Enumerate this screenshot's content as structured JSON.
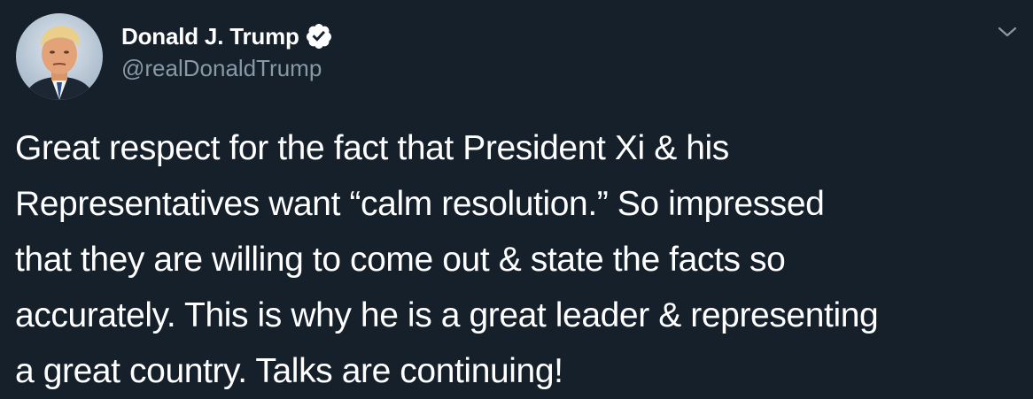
{
  "author": {
    "display_name": "Donald J. Trump",
    "handle": "@realDonaldTrump",
    "verified": true,
    "avatar_icon": "profile-photo",
    "verified_icon": "verified-badge-icon"
  },
  "menu": {
    "icon": "chevron-down-icon"
  },
  "tweet": {
    "lines": [
      "Great respect for the fact that President Xi & his",
      "Representatives want “calm resolution.” So impressed",
      "that they are willing to come out & state the facts so",
      "accurately. This is why he is a great leader & representing",
      "a great country. Talks are continuing!"
    ]
  },
  "colors": {
    "background": "#15202b",
    "text": "#ffffff",
    "secondary_text": "#8899a6",
    "badge": "#ffffff"
  }
}
